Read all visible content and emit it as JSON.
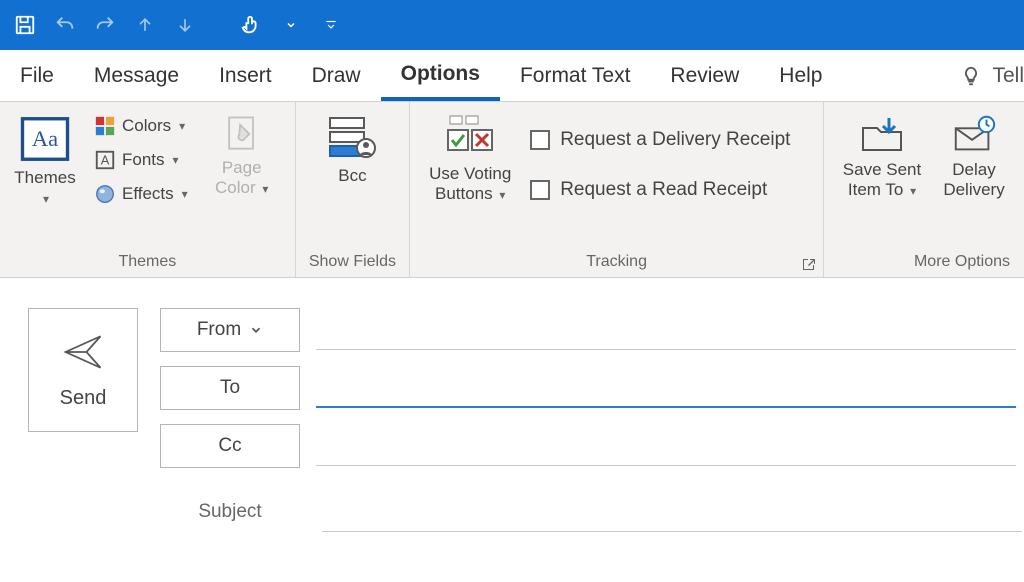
{
  "qat": {
    "save": "save",
    "undo": "undo",
    "redo": "redo",
    "up": "up",
    "down": "down",
    "touch": "touch",
    "more": "more"
  },
  "tabs": {
    "file": "File",
    "message": "Message",
    "insert": "Insert",
    "draw": "Draw",
    "options": "Options",
    "format_text": "Format Text",
    "review": "Review",
    "help": "Help",
    "tell": "Tell"
  },
  "ribbon": {
    "themes_group": {
      "label": "Themes",
      "themes_btn": "Themes",
      "colors": "Colors",
      "fonts": "Fonts",
      "effects": "Effects"
    },
    "page_color": {
      "label1": "Page",
      "label2": "Color"
    },
    "show_fields_group": {
      "label": "Show Fields",
      "bcc": "Bcc"
    },
    "tracking_group": {
      "label": "Tracking",
      "voting1": "Use Voting",
      "voting2": "Buttons",
      "delivery_receipt": "Request a Delivery Receipt",
      "read_receipt": "Request a Read Receipt"
    },
    "more_options_group": {
      "label": "More Options",
      "save_sent1": "Save Sent",
      "save_sent2": "Item To",
      "delay1": "Delay",
      "delay2": "Delivery"
    }
  },
  "compose": {
    "send": "Send",
    "from": "From",
    "to": "To",
    "cc": "Cc",
    "subject": "Subject",
    "from_value": "",
    "to_value": "",
    "cc_value": "",
    "subject_value": ""
  }
}
